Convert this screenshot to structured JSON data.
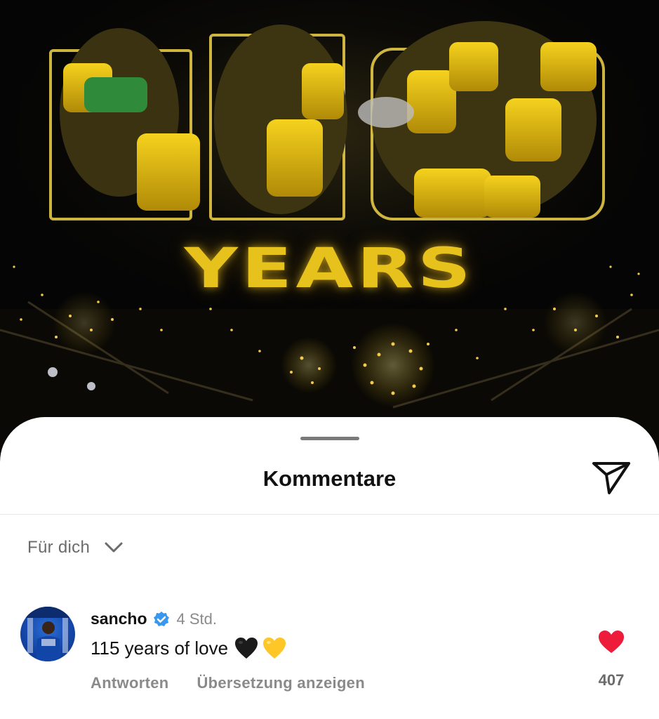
{
  "post": {
    "banner_text": "YEARS"
  },
  "sheet": {
    "title": "Kommentare",
    "filter_label": "Für dich"
  },
  "comment": {
    "username": "sancho",
    "timestamp": "4 Std.",
    "text": "115 years of love",
    "emojis": [
      "black-heart-icon",
      "yellow-heart-icon"
    ],
    "reply_label": "Antworten",
    "translate_label": "Übersetzung anzeigen",
    "like_count": "407",
    "liked": true
  },
  "colors": {
    "accent_yellow": "#e8c21c",
    "like_red": "#ed1c3a",
    "verified_blue": "#3897f0"
  }
}
